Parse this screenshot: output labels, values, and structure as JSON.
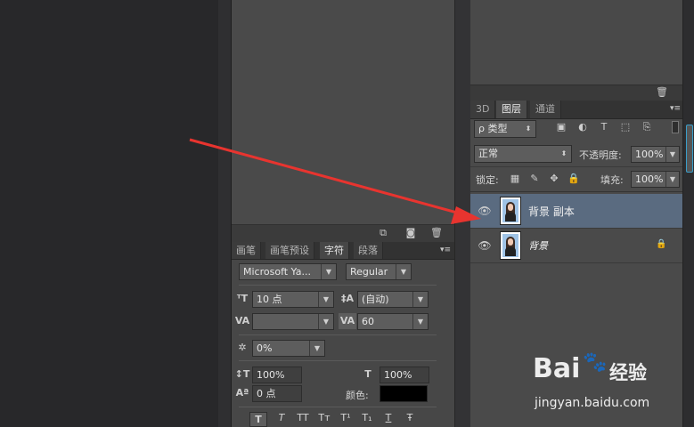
{
  "mid_toolbar": {
    "icons": [
      "new-frame-icon",
      "camera-icon",
      "trash-icon"
    ]
  },
  "char_panel": {
    "tabs": [
      "画笔",
      "画笔预设",
      "字符",
      "段落"
    ],
    "font_family": "Microsoft Ya...",
    "font_style": "Regular",
    "font_size": "10 点",
    "leading": "(自动)",
    "kerning": "",
    "tracking": "60",
    "baseline_scale": "0%",
    "vertical_scale": "100%",
    "horizontal_scale": "100%",
    "baseline_shift": "0 点",
    "color_label": "颜色:",
    "color_value": "#000000",
    "style_buttons": [
      "T",
      "T",
      "TT",
      "Tт",
      "T¹",
      "T₁",
      "T",
      "Ŧ"
    ]
  },
  "layers_panel": {
    "tabs": [
      "3D",
      "图层",
      "通道"
    ],
    "filter_label": "ρ 类型",
    "blend_mode": "正常",
    "opacity_label": "不透明度:",
    "opacity_value": "100%",
    "lock_label": "锁定:",
    "fill_label": "填充:",
    "fill_value": "100%",
    "layers": [
      {
        "name": "背景 副本",
        "selected": true
      },
      {
        "name": "背景",
        "selected": false,
        "locked": true
      }
    ]
  },
  "watermark": {
    "brand": "Bai",
    "brand_cn": "经验",
    "url": "jingyan.baidu.com"
  },
  "colors": {
    "selected_row": "#5a6b80",
    "arrow": "#e8342f"
  }
}
